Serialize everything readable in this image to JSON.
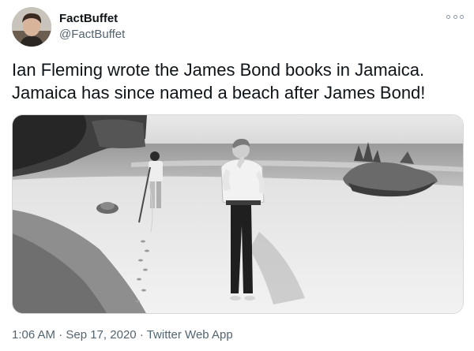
{
  "author": {
    "display_name": "FactBuffet",
    "handle": "@FactBuffet",
    "avatar_icon": "avatar-photo"
  },
  "menu": {
    "icon": "more-options-icon"
  },
  "tweet": {
    "line1": "Ian Fleming wrote the James Bond books in Jamaica.",
    "line2": "Jamaica has since named a beach after James Bond!"
  },
  "meta": {
    "time": "1:06 AM",
    "sep1": "·",
    "date": "Sep 17, 2020",
    "sep2": "·",
    "source": "Twitter Web App"
  },
  "colors": {
    "text": "#0f1419",
    "secondary": "#536471",
    "border": "#d5d8da"
  }
}
